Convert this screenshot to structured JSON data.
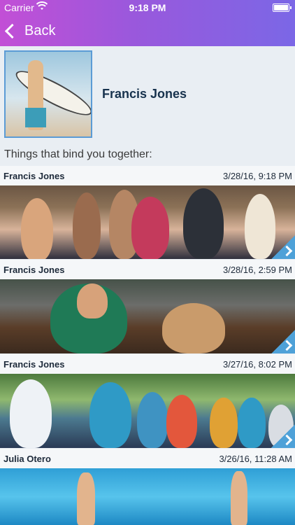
{
  "status_bar": {
    "carrier": "Carrier",
    "time": "9:18 PM"
  },
  "nav": {
    "back_label": "Back"
  },
  "profile": {
    "name": "Francis Jones"
  },
  "section_label": "Things that bind you together:",
  "feed": [
    {
      "author": "Francis Jones",
      "timestamp": "3/28/16, 9:18 PM"
    },
    {
      "author": "Francis Jones",
      "timestamp": "3/28/16, 2:59 PM"
    },
    {
      "author": "Francis Jones",
      "timestamp": "3/27/16, 8:02 PM"
    },
    {
      "author": "Julia Otero",
      "timestamp": "3/26/16, 11:28 AM"
    }
  ],
  "colors": {
    "header_start": "#c24fd6",
    "header_end": "#7b67e6",
    "accent": "#4ea1d8",
    "name_text": "#17324d"
  },
  "icons": [
    "wifi-icon",
    "battery-icon",
    "chevron-left-icon",
    "chevron-right-icon"
  ]
}
